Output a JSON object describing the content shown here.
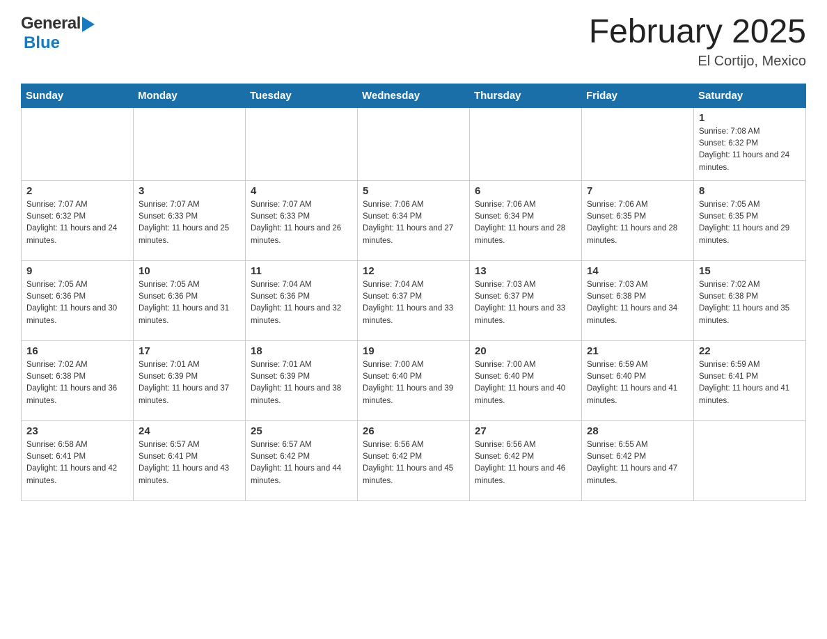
{
  "header": {
    "logo": {
      "general": "General",
      "blue": "Blue",
      "triangle_color": "#1a7abf"
    },
    "title": "February 2025",
    "location": "El Cortijo, Mexico"
  },
  "days_of_week": [
    "Sunday",
    "Monday",
    "Tuesday",
    "Wednesday",
    "Thursday",
    "Friday",
    "Saturday"
  ],
  "weeks": [
    [
      {
        "day": "",
        "info": ""
      },
      {
        "day": "",
        "info": ""
      },
      {
        "day": "",
        "info": ""
      },
      {
        "day": "",
        "info": ""
      },
      {
        "day": "",
        "info": ""
      },
      {
        "day": "",
        "info": ""
      },
      {
        "day": "1",
        "info": "Sunrise: 7:08 AM\nSunset: 6:32 PM\nDaylight: 11 hours and 24 minutes."
      }
    ],
    [
      {
        "day": "2",
        "info": "Sunrise: 7:07 AM\nSunset: 6:32 PM\nDaylight: 11 hours and 24 minutes."
      },
      {
        "day": "3",
        "info": "Sunrise: 7:07 AM\nSunset: 6:33 PM\nDaylight: 11 hours and 25 minutes."
      },
      {
        "day": "4",
        "info": "Sunrise: 7:07 AM\nSunset: 6:33 PM\nDaylight: 11 hours and 26 minutes."
      },
      {
        "day": "5",
        "info": "Sunrise: 7:06 AM\nSunset: 6:34 PM\nDaylight: 11 hours and 27 minutes."
      },
      {
        "day": "6",
        "info": "Sunrise: 7:06 AM\nSunset: 6:34 PM\nDaylight: 11 hours and 28 minutes."
      },
      {
        "day": "7",
        "info": "Sunrise: 7:06 AM\nSunset: 6:35 PM\nDaylight: 11 hours and 28 minutes."
      },
      {
        "day": "8",
        "info": "Sunrise: 7:05 AM\nSunset: 6:35 PM\nDaylight: 11 hours and 29 minutes."
      }
    ],
    [
      {
        "day": "9",
        "info": "Sunrise: 7:05 AM\nSunset: 6:36 PM\nDaylight: 11 hours and 30 minutes."
      },
      {
        "day": "10",
        "info": "Sunrise: 7:05 AM\nSunset: 6:36 PM\nDaylight: 11 hours and 31 minutes."
      },
      {
        "day": "11",
        "info": "Sunrise: 7:04 AM\nSunset: 6:36 PM\nDaylight: 11 hours and 32 minutes."
      },
      {
        "day": "12",
        "info": "Sunrise: 7:04 AM\nSunset: 6:37 PM\nDaylight: 11 hours and 33 minutes."
      },
      {
        "day": "13",
        "info": "Sunrise: 7:03 AM\nSunset: 6:37 PM\nDaylight: 11 hours and 33 minutes."
      },
      {
        "day": "14",
        "info": "Sunrise: 7:03 AM\nSunset: 6:38 PM\nDaylight: 11 hours and 34 minutes."
      },
      {
        "day": "15",
        "info": "Sunrise: 7:02 AM\nSunset: 6:38 PM\nDaylight: 11 hours and 35 minutes."
      }
    ],
    [
      {
        "day": "16",
        "info": "Sunrise: 7:02 AM\nSunset: 6:38 PM\nDaylight: 11 hours and 36 minutes."
      },
      {
        "day": "17",
        "info": "Sunrise: 7:01 AM\nSunset: 6:39 PM\nDaylight: 11 hours and 37 minutes."
      },
      {
        "day": "18",
        "info": "Sunrise: 7:01 AM\nSunset: 6:39 PM\nDaylight: 11 hours and 38 minutes."
      },
      {
        "day": "19",
        "info": "Sunrise: 7:00 AM\nSunset: 6:40 PM\nDaylight: 11 hours and 39 minutes."
      },
      {
        "day": "20",
        "info": "Sunrise: 7:00 AM\nSunset: 6:40 PM\nDaylight: 11 hours and 40 minutes."
      },
      {
        "day": "21",
        "info": "Sunrise: 6:59 AM\nSunset: 6:40 PM\nDaylight: 11 hours and 41 minutes."
      },
      {
        "day": "22",
        "info": "Sunrise: 6:59 AM\nSunset: 6:41 PM\nDaylight: 11 hours and 41 minutes."
      }
    ],
    [
      {
        "day": "23",
        "info": "Sunrise: 6:58 AM\nSunset: 6:41 PM\nDaylight: 11 hours and 42 minutes."
      },
      {
        "day": "24",
        "info": "Sunrise: 6:57 AM\nSunset: 6:41 PM\nDaylight: 11 hours and 43 minutes."
      },
      {
        "day": "25",
        "info": "Sunrise: 6:57 AM\nSunset: 6:42 PM\nDaylight: 11 hours and 44 minutes."
      },
      {
        "day": "26",
        "info": "Sunrise: 6:56 AM\nSunset: 6:42 PM\nDaylight: 11 hours and 45 minutes."
      },
      {
        "day": "27",
        "info": "Sunrise: 6:56 AM\nSunset: 6:42 PM\nDaylight: 11 hours and 46 minutes."
      },
      {
        "day": "28",
        "info": "Sunrise: 6:55 AM\nSunset: 6:42 PM\nDaylight: 11 hours and 47 minutes."
      },
      {
        "day": "",
        "info": ""
      }
    ]
  ]
}
